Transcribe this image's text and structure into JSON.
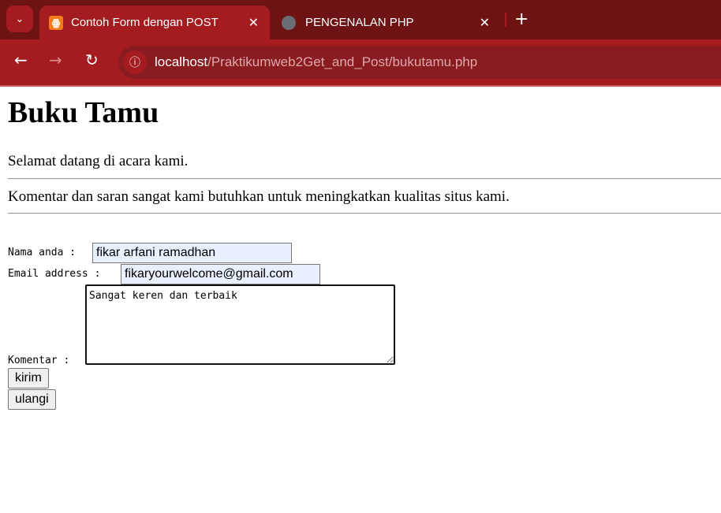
{
  "browser": {
    "tabs": [
      {
        "title": "Contoh Form dengan POST",
        "active": true,
        "icon": "xampp-icon"
      },
      {
        "title": "PENGENALAN PHP",
        "active": false,
        "icon": "globe-icon"
      }
    ],
    "url_host": "localhost",
    "url_path": "/Praktikumweb2Get_and_Post/bukutamu.php",
    "colors": {
      "tabbar": "#6d1314",
      "toolbar": "#a51c20",
      "omnibox": "#881c20"
    }
  },
  "page": {
    "title": "Buku Tamu",
    "welcome": "Selamat datang di acara kami.",
    "intro": "Komentar dan saran sangat kami butuhkan untuk meningkatkan kualitas situs kami.",
    "form": {
      "name_label": "Nama anda :",
      "name_value": "fikar arfani ramadhan",
      "email_label": "Email address :",
      "email_value": "fikaryourwelcome@gmail.com",
      "comment_label": "Komentar :",
      "comment_value": "Sangat keren dan terbaik",
      "submit_label": "kirim",
      "reset_label": "ulangi"
    }
  }
}
